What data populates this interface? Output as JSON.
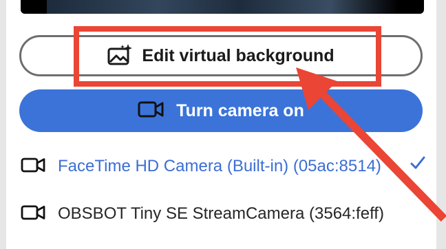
{
  "edit_background": {
    "label": "Edit virtual background",
    "icon": "image-sparkle-icon"
  },
  "camera_toggle": {
    "label": "Turn camera on",
    "icon": "video-camera-icon"
  },
  "camera_list": [
    {
      "label": "FaceTime HD Camera (Built-in) (05ac:8514)",
      "selected": true,
      "icon": "video-camera-icon"
    },
    {
      "label": "OBSBOT Tiny SE StreamCamera (3564:feff)",
      "selected": false,
      "icon": "video-camera-icon"
    }
  ],
  "colors": {
    "accent": "#3b73d9",
    "annotation": "#ea4535",
    "selected_text": "#3b6ed4"
  }
}
